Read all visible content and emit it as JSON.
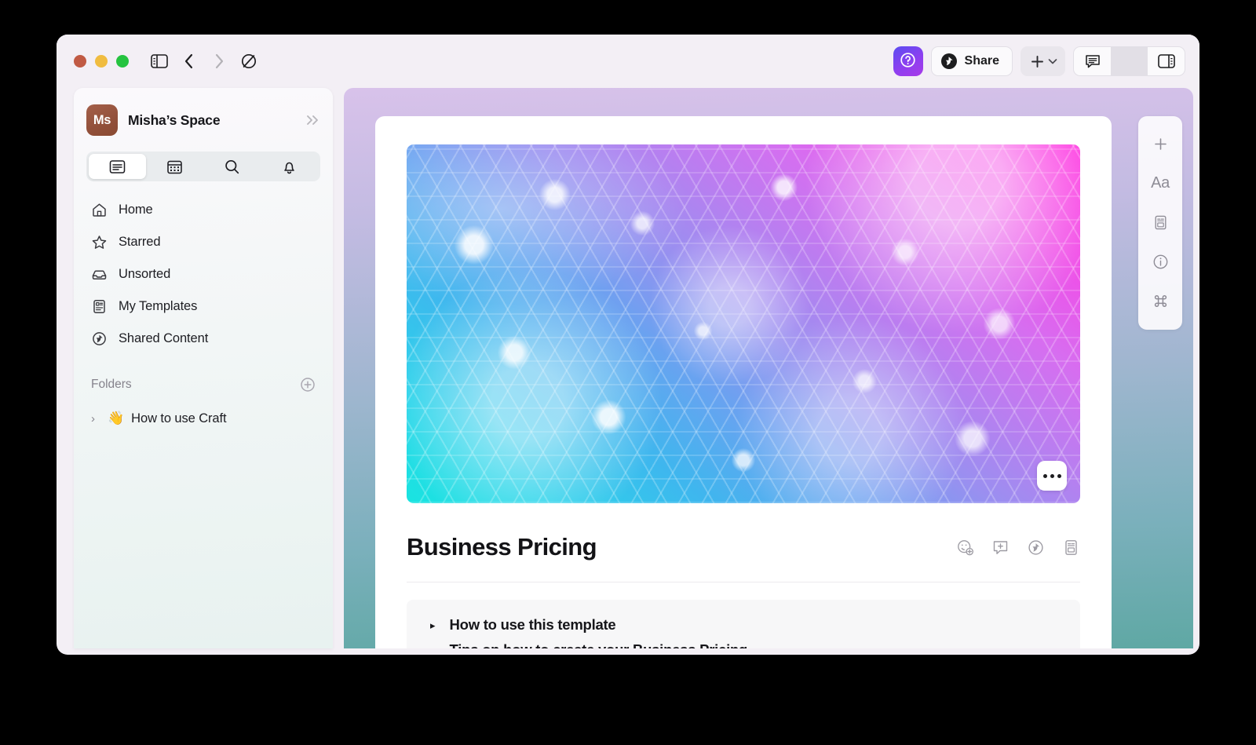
{
  "window": {
    "traffic_lights": [
      "close",
      "minimize",
      "zoom"
    ]
  },
  "toolbar": {
    "sidebar_toggle_icon": "sidebar-toggle-icon",
    "back_icon": "chevron-left-icon",
    "forward_icon": "chevron-right-icon",
    "focus_icon": "do-not-disturb-icon",
    "help_label": "?",
    "help_icon": "question-mark-icon",
    "share_label": "Share",
    "share_icon": "share-arrow-icon",
    "add_icon": "plus-icon",
    "add_chevron_icon": "chevron-down-icon",
    "comment_icon": "comment-bubble-icon",
    "right_panel_icon": "right-sidebar-icon",
    "accent_color": "#7b3ef0"
  },
  "sidebar": {
    "space": {
      "avatar_initials": "Ms",
      "name": "Misha’s Space",
      "avatar_color": "#92503a",
      "expand_icon": "chevrons-right-icon"
    },
    "tabs": [
      {
        "name": "documents",
        "icon": "document-icon",
        "active": true
      },
      {
        "name": "calendar",
        "icon": "calendar-icon",
        "active": false
      },
      {
        "name": "search",
        "icon": "search-icon",
        "active": false
      },
      {
        "name": "notifications",
        "icon": "bell-icon",
        "active": false
      }
    ],
    "nav": [
      {
        "label": "Home",
        "icon": "home-icon"
      },
      {
        "label": "Starred",
        "icon": "star-icon"
      },
      {
        "label": "Unsorted",
        "icon": "inbox-icon"
      },
      {
        "label": "My Templates",
        "icon": "template-icon"
      },
      {
        "label": "Shared Content",
        "icon": "shared-arrow-icon"
      }
    ],
    "folders": {
      "title": "Folders",
      "add_icon": "plus-circle-icon",
      "items": [
        {
          "emoji": "👋",
          "label": "How to use Craft",
          "chevron": "›"
        }
      ]
    }
  },
  "document": {
    "title": "Business Pricing",
    "hero": {
      "more_icon": "ellipsis-icon",
      "gradient_from": "#19e4e0",
      "gradient_to": "#ff2fe0"
    },
    "title_actions": [
      {
        "name": "add-reaction",
        "icon": "smiley-plus-icon"
      },
      {
        "name": "add-comment",
        "icon": "comment-plus-icon"
      },
      {
        "name": "share-block",
        "icon": "share-circle-icon"
      },
      {
        "name": "card-preview",
        "icon": "card-icon"
      }
    ],
    "toggles": [
      {
        "arrow": "▸",
        "label": "How to use this template"
      },
      {
        "arrow": "▸",
        "label": "Tips on how to create your Business Pricing"
      }
    ],
    "background_gradient": {
      "top": "#d8c2ea",
      "bottom": "#5fa8a4"
    }
  },
  "right_toolbar": [
    {
      "name": "insert-block",
      "icon": "plus-icon",
      "glyph": ""
    },
    {
      "name": "text-style",
      "icon": "text-style-icon",
      "glyph": "Aa"
    },
    {
      "name": "card-style",
      "icon": "card-style-icon",
      "glyph": ""
    },
    {
      "name": "document-info",
      "icon": "info-circle-icon",
      "glyph": ""
    },
    {
      "name": "shortcuts",
      "icon": "command-icon",
      "glyph": ""
    }
  ]
}
